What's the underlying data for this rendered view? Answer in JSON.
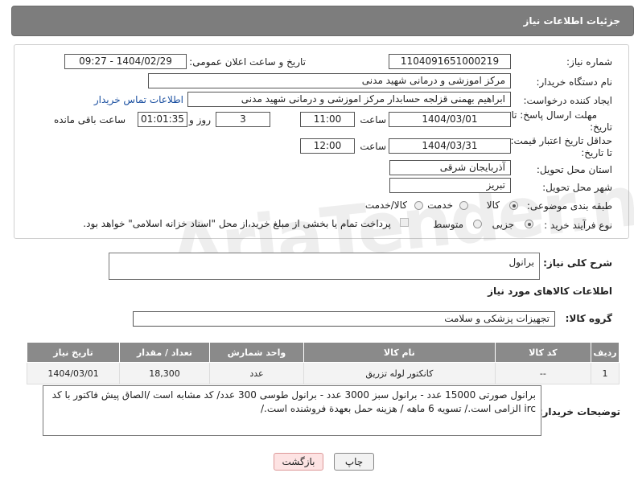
{
  "header": {
    "title": "جزئیات اطلاعات نیاز"
  },
  "form": {
    "need_number_label": "شماره نیاز:",
    "need_number": "1104091651000219",
    "announce_label": "تاریخ و ساعت اعلان عمومی:",
    "announce_value": "1404/02/29 - 09:27",
    "buyer_org_label": "نام دستگاه خریدار:",
    "buyer_org": "مرکز اموزشی و درمانی شهید مدنی",
    "requester_label": "ایجاد کننده درخواست:",
    "requester": "ابراهیم بهمنی قزلجه حسابدار مرکز اموزشی و درمانی شهید مدنی",
    "contact_link": "اطلاعات تماس خریدار",
    "deadline_label_1": "مهلت ارسال پاسخ: تا",
    "deadline_label_2": "تاریخ:",
    "deadline_date": "1404/03/01",
    "time_label": "ساعت",
    "deadline_time": "11:00",
    "days_value": "3",
    "days_label": "روز و",
    "remaining_value": "01:01:35",
    "remaining_label": "ساعت باقی مانده",
    "validity_label_1": "حداقل تاریخ اعتبار قیمت:",
    "validity_label_2": "تا تاریخ:",
    "validity_date": "1404/03/31",
    "validity_time": "12:00",
    "province_label": "استان محل تحویل:",
    "province": "آذربایجان شرقی",
    "city_label": "شهر محل تحویل:",
    "city": "تبریز",
    "category_label": "طبقه بندی موضوعی:",
    "category_options": [
      "کالا",
      "خدمت",
      "کالا/خدمت"
    ],
    "category_selected": "کالا",
    "process_label": "نوع فرآیند خرید :",
    "process_options": [
      "جزیی",
      "متوسط"
    ],
    "process_selected": "جزیی",
    "payment_note": "پرداخت تمام یا بخشی از مبلغ خرید،از محل \"اسناد خزانه اسلامی\" خواهد بود."
  },
  "watermark": "AriaTender.neT",
  "description": {
    "label": "شرح کلی نیاز:",
    "value": "برانول"
  },
  "goods": {
    "section_title": "اطلاعات کالاهای مورد نیاز",
    "group_label": "گروه کالا:",
    "group_value": "تجهیزات پزشکی و سلامت",
    "columns": [
      "ردیف",
      "کد کالا",
      "نام کالا",
      "واحد شمارش",
      "تعداد / مقدار",
      "تاریخ نیاز"
    ],
    "rows": [
      {
        "row": "1",
        "code": "--",
        "name": "کانکتور لوله تزریق",
        "unit": "عدد",
        "qty": "18,300",
        "date": "1404/03/01"
      }
    ]
  },
  "buyer_notes": {
    "label": "توضیحات خریدار:",
    "value": "برانول صورتی 15000 عدد - برانول سبز 3000 عدد - برانول طوسی 300 عدد/ کد مشابه است /الصاق پیش فاکتور با کد irc الزامی است./ تسویه 6 ماهه / هزینه حمل بعهدة فروشنده است./"
  },
  "buttons": {
    "print": "چاپ",
    "back": "بازگشت"
  }
}
